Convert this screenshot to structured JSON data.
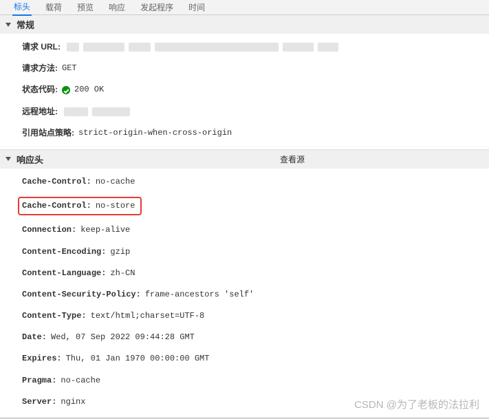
{
  "tabs": {
    "t1": "标头",
    "t2": "载荷",
    "t3": "预览",
    "t4": "响应",
    "t5": "发起程序",
    "t6": "时间"
  },
  "general": {
    "title": "常规",
    "request_url_label": "请求 URL:",
    "request_method_label": "请求方法:",
    "request_method_value": "GET",
    "status_code_label": "状态代码:",
    "status_code_value": "200 OK",
    "remote_addr_label": "远程地址:",
    "referrer_policy_label": "引用站点策略:",
    "referrer_policy_value": "strict-origin-when-cross-origin"
  },
  "response": {
    "title": "响应头",
    "view_source": "查看源",
    "headers": [
      {
        "name": "Cache-Control:",
        "value": "no-cache"
      },
      {
        "name": "Cache-Control:",
        "value": "no-store",
        "highlight": true
      },
      {
        "name": "Connection:",
        "value": "keep-alive"
      },
      {
        "name": "Content-Encoding:",
        "value": "gzip"
      },
      {
        "name": "Content-Language:",
        "value": "zh-CN"
      },
      {
        "name": "Content-Security-Policy:",
        "value": "frame-ancestors 'self'"
      },
      {
        "name": "Content-Type:",
        "value": "text/html;charset=UTF-8"
      },
      {
        "name": "Date:",
        "value": "Wed, 07 Sep 2022 09:44:28 GMT"
      },
      {
        "name": "Expires:",
        "value": "Thu, 01 Jan 1970 00:00:00 GMT"
      },
      {
        "name": "Pragma:",
        "value": "no-cache"
      },
      {
        "name": "Server:",
        "value": "nginx"
      }
    ]
  },
  "watermark": "CSDN @为了老板的法拉利"
}
